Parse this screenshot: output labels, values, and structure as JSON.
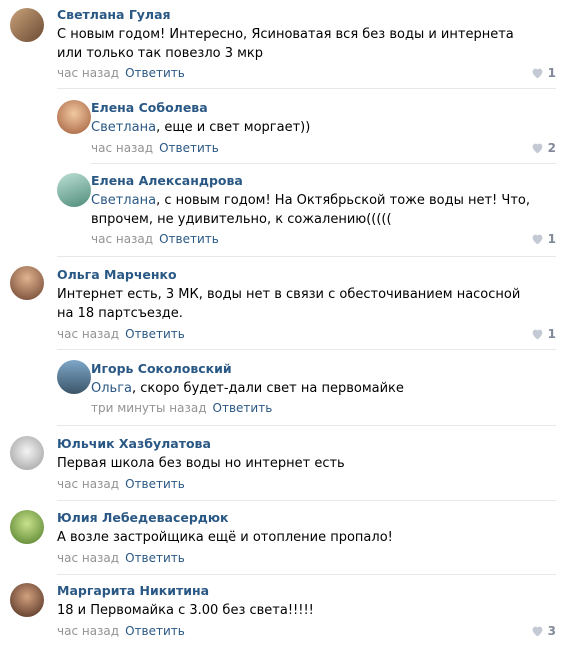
{
  "comments": [
    {
      "author": "Светлана Гулая",
      "text": "С новым годом! Интересно, Ясиноватая вся без воды и интернета или только так повезло 3 мкр",
      "time": "час назад",
      "reply": "Ответить",
      "likes": "1"
    },
    {
      "author": "Елена Соболева",
      "mention": "Светлана",
      "text": ", еще и свет моргает))",
      "time": "час назад",
      "reply": "Ответить",
      "likes": "2"
    },
    {
      "author": "Елена Александрова",
      "mention": "Светлана",
      "text": ", с новым годом! На Октябрьской тоже воды нет! Что, впрочем, не удивительно, к сожалению(((((",
      "time": "час назад",
      "reply": "Ответить",
      "likes": "1"
    },
    {
      "author": "Ольга Марченко",
      "text": "Интернет есть, 3 МК, воды нет в связи с обесточиванием насосной на 18 партсъезде.",
      "time": "час назад",
      "reply": "Ответить",
      "likes": "1"
    },
    {
      "author": "Игорь Соколовский",
      "mention": "Ольга",
      "text": ", скоро будет-дали свет на первомайке",
      "time": "три минуты назад",
      "reply": "Ответить"
    },
    {
      "author": "Юльчик Хазбулатова",
      "text": "Первая школа без воды но интернет есть",
      "time": "час назад",
      "reply": "Ответить"
    },
    {
      "author": "Юлия Лебедевасердюк",
      "text": "А возле застройщика ещё и отопление пропало!",
      "time": "час назад",
      "reply": "Ответить"
    },
    {
      "author": "Маргарита Никитина",
      "text": "18 и Первомайка с 3.00 без света!!!!!",
      "time": "час назад",
      "reply": "Ответить",
      "likes": "3"
    }
  ],
  "colors": {
    "link": "#2a5885",
    "meta": "#939393",
    "like": "#828a99",
    "separator": "#e7e8ec"
  }
}
